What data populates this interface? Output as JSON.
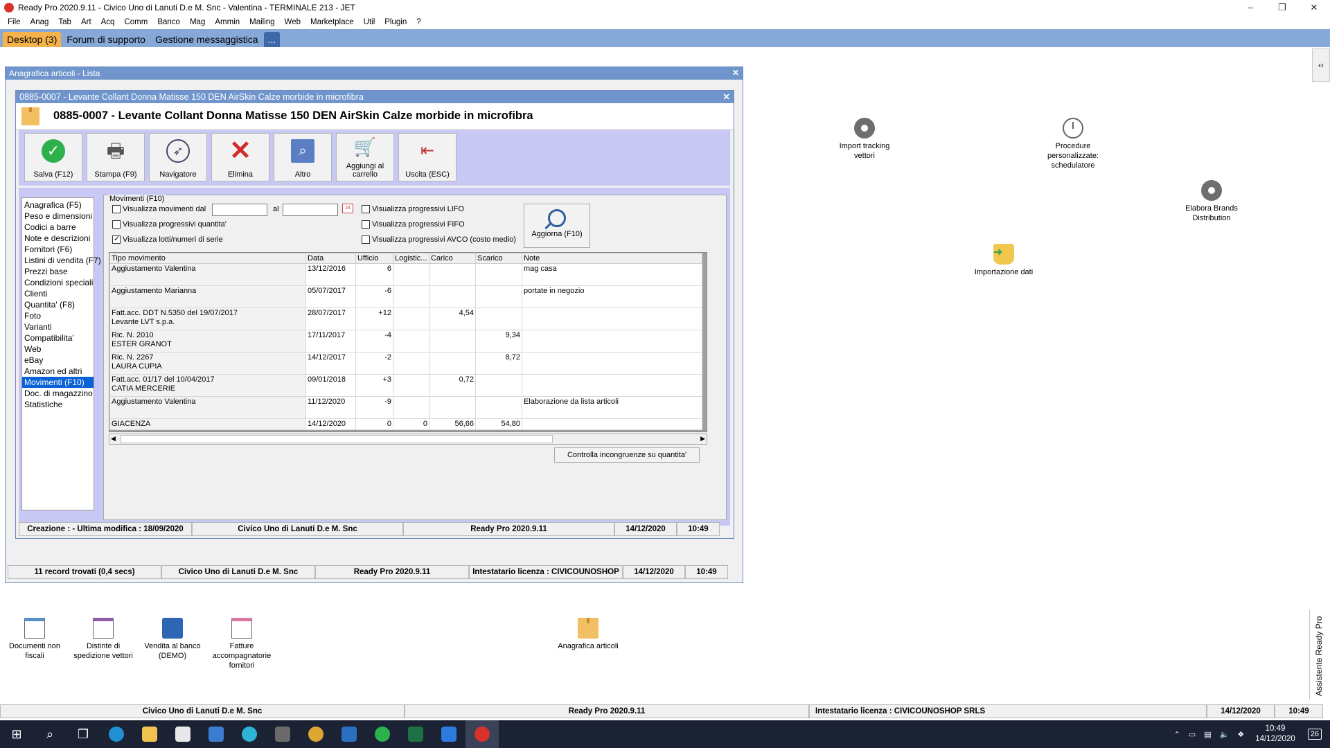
{
  "app": {
    "title": "Ready Pro 2020.9.11 - Civico Uno di Lanuti D.e M. Snc - Valentina - TERMINALE 213 - JET"
  },
  "menu": [
    "File",
    "Anag",
    "Tab",
    "Art",
    "Acq",
    "Comm",
    "Banco",
    "Mag",
    "Ammin",
    "Mailing",
    "Web",
    "Marketplace",
    "Util",
    "Plugin",
    "?"
  ],
  "tabs": [
    {
      "label": "Desktop (3)"
    },
    {
      "label": "Forum di supporto"
    },
    {
      "label": "Gestione messaggistica"
    },
    {
      "label": "..."
    }
  ],
  "collapse_label": "‹‹",
  "assistente_label": "Assistente Ready Pro",
  "desktop_icons": {
    "import_tracking": "Import tracking\nvettori",
    "procedure": "Procedure\npersonalizzate:\nschedulatore",
    "elabora_brands": "Elabora Brands\nDistribution",
    "importazione": "Importazione dati",
    "documenti_non_fiscali": "Documenti non\nfiscali",
    "distinte": "Distinte di\nspedizione vettori",
    "vendita_banco": "Vendita al banco\n(DEMO)",
    "fatture": "Fatture\naccompagnatorie\nfornitori",
    "anagrafica": "Anagrafica articoli"
  },
  "outer_window": {
    "title": "Anagrafica articoli  - Lista",
    "status": {
      "records": "11 record trovati (0,4 secs)",
      "company": "Civico Uno di Lanuti D.e M. Snc",
      "version": "Ready Pro 2020.9.11",
      "license": "Intestatario licenza : CIVICOUNOSHOP",
      "date": "14/12/2020",
      "time": "10:49"
    }
  },
  "inner_window": {
    "title": "0885-0007 - Levante Collant Donna Matisse 150 DEN AirSkin Calze morbide in microfibra",
    "header": "0885-0007 - Levante Collant Donna Matisse 150 DEN AirSkin Calze morbide in microfibra",
    "toolbar": {
      "salva": "Salva (F12)",
      "stampa": "Stampa (F9)",
      "navigatore": "Navigatore",
      "elimina": "Elimina",
      "altro": "Altro",
      "aggiungi": "Aggiungi al\ncarrello",
      "uscita": "Uscita (ESC)"
    },
    "sections": [
      "Anagrafica (F5)",
      "Peso e dimensioni",
      "Codici a barre",
      "Note e descrizioni",
      "Fornitori (F6)",
      "Listini di vendita (F7)",
      "Prezzi base",
      "Condizioni speciali",
      "Clienti",
      "Quantita' (F8)",
      "Foto",
      "Varianti",
      "Compatibilita'",
      "Web",
      "eBay",
      "Amazon ed altri",
      "Movimenti (F10)",
      "Doc. di magazzino",
      "Statistiche"
    ],
    "selected_section": 16,
    "movimenti": {
      "group_title": "Movimenti (F10)",
      "chk_dal": "Visualizza movimenti dal",
      "al": "al",
      "chk_prog_qta": "Visualizza progressivi quantita'",
      "chk_lotti": "Visualizza lotti/numeri di serie",
      "chk_lifo": "Visualizza progressivi LIFO",
      "chk_fifo": "Visualizza progressivi FIFO",
      "chk_avco": "Visualizza progressivi AVCO (costo medio)",
      "date_from": "",
      "date_to": "",
      "cal_label": "24",
      "aggiorna": "Aggiorna (F10)",
      "controlla": "Controlla incongruenze su quantita'",
      "columns": [
        "Tipo movimento",
        "Data",
        "Ufficio",
        "Logistic...",
        "Carico",
        "Scarico",
        "Note"
      ],
      "rows": [
        [
          "Aggiustamento Valentina",
          "13/12/2016",
          "6",
          "",
          "",
          "",
          "mag casa"
        ],
        [
          "Aggiustamento Marianna",
          "05/07/2017",
          "-6",
          "",
          "",
          "",
          "portate in negozio"
        ],
        [
          "Fatt.acc. DDT N.5350 del 19/07/2017\nLevante LVT s.p.a.",
          "28/07/2017",
          "+12",
          "",
          "4,54",
          "",
          ""
        ],
        [
          "Ric. N. 2010\nESTER GRANOT",
          "17/11/2017",
          "-4",
          "",
          "",
          "9,34",
          ""
        ],
        [
          "Ric. N. 2267\nLAURA CUPIA",
          "14/12/2017",
          "-2",
          "",
          "",
          "8,72",
          ""
        ],
        [
          "Fatt.acc. 01/17 del 10/04/2017\nCATIA MERCERIE",
          "09/01/2018",
          "+3",
          "",
          "0,72",
          "",
          ""
        ],
        [
          "Aggiustamento Valentina",
          "11/12/2020",
          "-9",
          "",
          "",
          "",
          "Elaborazione da lista articoli"
        ]
      ],
      "giacenza": [
        "GIACENZA",
        "14/12/2020",
        "0",
        "0",
        "56,66",
        "54,80",
        ""
      ]
    },
    "status": {
      "creazione": "Creazione :  - Ultima modifica : 18/09/2020",
      "company": "Civico Uno di Lanuti D.e M. Snc",
      "version": "Ready Pro 2020.9.11",
      "date": "14/12/2020",
      "time": "10:49"
    }
  },
  "bottom_status": {
    "company": "Civico Uno di Lanuti D.e M. Snc",
    "version": "Ready Pro 2020.9.11",
    "license": "Intestatario licenza : CIVICOUNOSHOP SRLS",
    "date": "14/12/2020",
    "time": "10:49"
  },
  "taskbar": {
    "time": "10:49",
    "date": "14/12/2020",
    "notifications": "26"
  }
}
